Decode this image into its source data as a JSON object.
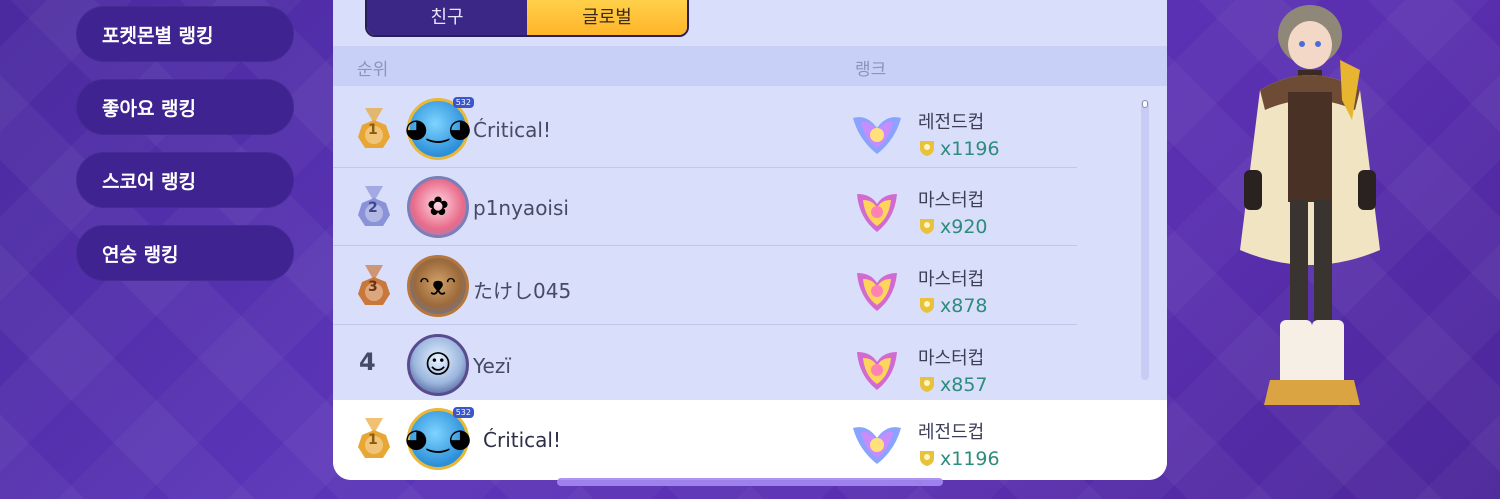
{
  "sidebar": {
    "items": [
      {
        "label": "포켓몬별 랭킹"
      },
      {
        "label": "좋아요 랭킹"
      },
      {
        "label": "스코어 랭킹"
      },
      {
        "label": "연승 랭킹"
      }
    ]
  },
  "tabs": {
    "friends": "친구",
    "global": "글로벌",
    "active": "global"
  },
  "header": {
    "rank_col": "순위",
    "tier_col": "랭크"
  },
  "rows": [
    {
      "rank": "1",
      "medal": "gold",
      "name": "Ćritical!",
      "cup": "레전드컵",
      "count": "x1196",
      "level": "532"
    },
    {
      "rank": "2",
      "medal": "silver",
      "name": "p1nyaoisi",
      "cup": "마스터컵",
      "count": "x920"
    },
    {
      "rank": "3",
      "medal": "bronze",
      "name": "たけし045",
      "cup": "마스터컵",
      "count": "x878"
    },
    {
      "rank": "4",
      "medal": "",
      "name": "Yezï",
      "cup": "마스터컵",
      "count": "x857"
    }
  ],
  "my_row": {
    "rank": "1",
    "medal": "gold",
    "name": "Ćritical!",
    "cup": "레전드컵",
    "count": "x1196",
    "level": "532"
  },
  "colors": {
    "accent": "#ffc637",
    "panel": "#d9defa",
    "background": "#5530b0",
    "count": "#2d8c7c"
  }
}
